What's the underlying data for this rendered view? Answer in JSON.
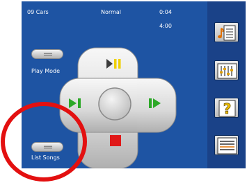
{
  "status": {
    "track": "09 Cars",
    "mode": "Normal",
    "elapsed": "0:04",
    "total": "4:00"
  },
  "buttons": {
    "play_mode": "Play Mode",
    "list_songs": "List Songs"
  },
  "icons": {
    "play_pause": "play-pause-icon",
    "previous": "previous-track-icon",
    "next": "next-track-icon",
    "stop": "stop-icon",
    "sidebar": [
      "music-note-icon",
      "equalizer-icon",
      "help-icon",
      "playlist-icon"
    ]
  },
  "colors": {
    "panel": "#1e54a3",
    "sidebar": "#1a4288",
    "accent_green": "#2ca827",
    "accent_yellow": "#f0d000",
    "stop_red": "#e01818",
    "highlight": "#e31010"
  }
}
